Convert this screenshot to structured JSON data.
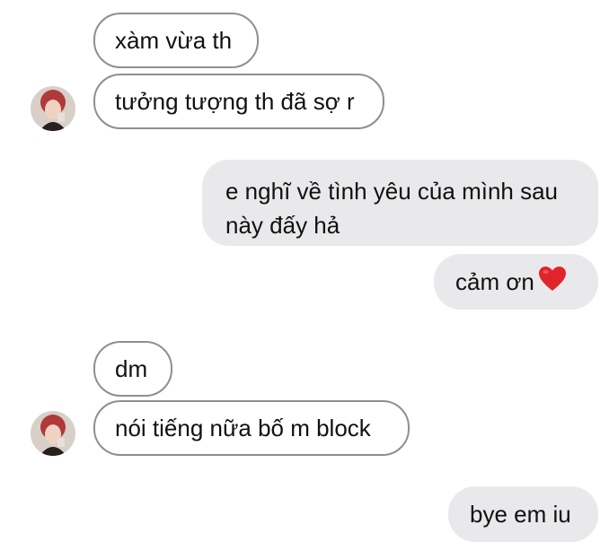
{
  "conversation": {
    "messages": [
      {
        "sender": "them",
        "text": "xàm vừa th"
      },
      {
        "sender": "them",
        "text": "tưởng tượng th đã sợ r"
      },
      {
        "sender": "me",
        "text": "e nghĩ về tình yêu của mình sau này đấy hả"
      },
      {
        "sender": "me",
        "text": "cảm ơn",
        "emoji": "heart-emoji"
      },
      {
        "sender": "them",
        "text": "dm"
      },
      {
        "sender": "them",
        "text": "nói tiếng nữa bố m block"
      },
      {
        "sender": "me",
        "text": "bye em iu"
      }
    ]
  },
  "colors": {
    "incoming_border": "#8e8e93",
    "outgoing_bg": "#e9e9eb",
    "heart": "#e0242b"
  }
}
